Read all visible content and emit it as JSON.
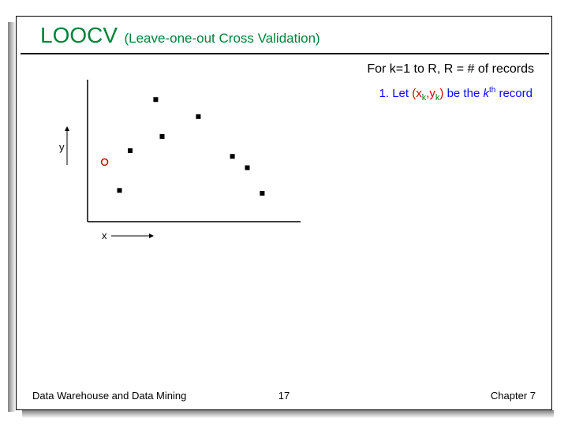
{
  "title": {
    "main": "LOOCV",
    "sub": "(Leave-one-out Cross Validation)"
  },
  "topRight": "For k=1 to R, R = # of records",
  "step": {
    "num": "1.",
    "prefix": "Let ",
    "xk_x": "x",
    "xk_k": "k",
    "yk_y": "y",
    "yk_k": "k",
    "mid": " be the ",
    "kth_k": "k",
    "kth_th": "th",
    "suffix": " record"
  },
  "axes": {
    "xlabel": "x",
    "ylabel": "y"
  },
  "footer": {
    "left": "Data Warehouse and Data Mining",
    "center": "17",
    "right": "Chapter 7"
  },
  "chart_data": {
    "type": "scatter",
    "title": "",
    "xlabel": "x",
    "ylabel": "y",
    "xlim": [
      0,
      10
    ],
    "ylim": [
      0,
      10
    ],
    "series": [
      {
        "name": "data-points",
        "marker": "filled-square",
        "color": "#000",
        "points": [
          {
            "x": 1.5,
            "y": 2.2
          },
          {
            "x": 2.0,
            "y": 5.0
          },
          {
            "x": 3.2,
            "y": 8.6
          },
          {
            "x": 3.5,
            "y": 6.0
          },
          {
            "x": 5.2,
            "y": 7.4
          },
          {
            "x": 6.8,
            "y": 4.6
          },
          {
            "x": 7.5,
            "y": 3.8
          },
          {
            "x": 8.2,
            "y": 2.0
          }
        ]
      },
      {
        "name": "left-out-point",
        "marker": "open-circle",
        "color": "#c00",
        "points": [
          {
            "x": 0.8,
            "y": 4.2
          }
        ]
      }
    ]
  }
}
